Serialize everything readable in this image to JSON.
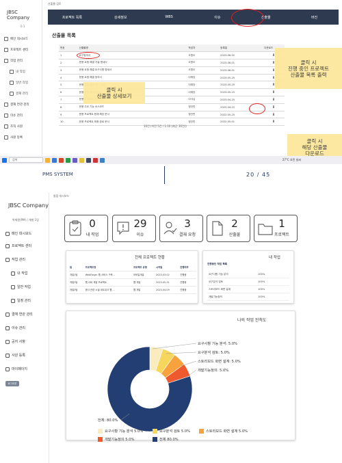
{
  "top": {
    "breadcrumb": "산출물 검토",
    "logo": "JBSC Company",
    "version": "0.1",
    "sidebar": [
      "메인 대시보드",
      "프로젝트 센터",
      "작업 관리",
      "내 작업",
      "일반 작업",
      "결재 관리",
      "결재 연관 관리",
      "이슈 관리",
      "조직 사원",
      "사원 등록"
    ],
    "nav": [
      "프로젝트 목록",
      "상세정보",
      "WBS",
      "이슈",
      "산출물",
      "버전"
    ],
    "page_title": "산출물 목록",
    "table": {
      "headers": [
        "번호",
        "산출물명",
        "작성자",
        "등록일",
        "다운로드"
      ],
      "rows": [
        [
          "1",
          "요구정의서",
          "오명오",
          "2023-06-02",
          "⬇"
        ],
        [
          "2",
          "운용 요청 해결 가설 명세서",
          "오명오",
          "2023-06-01",
          "⬇"
        ],
        [
          "3",
          "운용 요청 해결 요구사항 명세서",
          "오명오",
          "2023-06-01",
          "⬇"
        ],
        [
          "4",
          "운용 요청 해결 정의서",
          "이재당",
          "2023-05-25",
          "⬇"
        ],
        [
          "5",
          "운용 요청 해결 코드 작성",
          "이재당",
          "2023-05-25",
          "⬇"
        ],
        [
          "6",
          "운용 요청 해결 테스트",
          "이재당",
          "2023-05-15",
          "⬇"
        ],
        [
          "7",
          "운용 프로젝트 소스코드",
          "이사님",
          "2023-04-25",
          "⬇"
        ],
        [
          "8",
          "운용 주요 기능 소스코드",
          "정인민",
          "2023-04-15",
          "⬇"
        ],
        [
          "9",
          "운용 프로젝트 현재 해당 문서",
          "정인민",
          "2022-05-25",
          "⬇"
        ],
        [
          "10",
          "운용 프로젝트 최종 완료 문서",
          "정인민",
          "2022-05-01",
          "⬇"
        ]
      ],
      "footer": "10건 (이전 5건 / 1-10 (최근 10건))"
    },
    "callouts": {
      "project_list": "클릭 시\n진행 중인 프로젝트\n산출물 목록 출력",
      "detail": "클릭 시\n산출물 상세보기",
      "download": "클릭 시\n해당 산출물\n다운로드"
    },
    "taskbar": {
      "search": "검색",
      "weather": "27°C 흐린 날씨"
    }
  },
  "divider": {
    "label": "PMS SYSTEM",
    "page": "20",
    "separator": "/",
    "total": "45"
  },
  "bottom": {
    "breadcrumb": "통합 대시보드",
    "logo": "JBSC Company",
    "user": "박재원(PM) / 개발 1팀",
    "sidebar": [
      "메인 대시보드",
      "프로젝트 센터",
      "작업 관리",
      "내 작업",
      "일반 작업",
      "일정 관리",
      "결재 연관 관리",
      "이슈 관리",
      "공지 사항",
      "사원 등록",
      "마이페이지"
    ],
    "logout": "로그아웃",
    "cards": [
      {
        "num": "0",
        "label": "내 작업",
        "icon": "clipboard-icon"
      },
      {
        "num": "29",
        "label": "이슈",
        "icon": "alert-icon"
      },
      {
        "num": "3",
        "label": "결재 요청",
        "icon": "approval-icon"
      },
      {
        "num": "2",
        "label": "산출물",
        "icon": "document-icon"
      },
      {
        "num": "1",
        "label": "프로젝트",
        "icon": "folder-icon"
      }
    ],
    "project_panel": {
      "title": "전체 프로젝트 현황",
      "headers": [
        "팀",
        "프로젝트명",
        "프로젝트 유형",
        "시작일",
        "진행여부"
      ],
      "rows": [
        [
          "개발1팀",
          "WebForge: 웹 서비스 구축...",
          "모바일개발",
          "2023-03-02",
          "진행중"
        ],
        [
          "개발2팀",
          "웹 서버 개발 프로젝트",
          "웹 개발",
          "2023-05-31",
          "진행중"
        ],
        [
          "개발3팀",
          "음식 관련 소셜 네트워크 웹 ...",
          "웹 개발",
          "2023-04-09",
          "진행중"
        ]
      ]
    },
    "task_panel": {
      "title": "내 작업",
      "header": "진행중인 작업 목록",
      "rows": [
        [
          "요구사항 기능 분석",
          "100%"
        ],
        [
          "요구분석 검토",
          "100%"
        ],
        [
          "스토리보드 화면 설계",
          "100%"
        ],
        [
          "개발기능정의",
          "100%"
        ]
      ]
    },
    "progress_panel": {
      "title": "나의 작업 진척도"
    }
  },
  "chart_data": {
    "type": "pie",
    "title": "나의 작업 진척도",
    "categories": [
      "요구사항 기능 분석",
      "요구분석 검토",
      "스토리보드 화면 설계",
      "개발기능정의",
      "전체"
    ],
    "values": [
      5.0,
      5.0,
      5.0,
      5.0,
      80.0
    ],
    "unit": "%",
    "colors": [
      "#fbecc0",
      "#f6d65c",
      "#f7a23c",
      "#ee5a2e",
      "#233e73"
    ],
    "labels": [
      "요구사항 기능 분석: 5.0%",
      "요구분석 검토: 5.0%",
      "스토리보드 화면 설계: 5.0%",
      "개발기능정의: 5.0%",
      "전체: 80.0%"
    ],
    "legend": [
      "요구사항 기능 분석 5.0%",
      "요구분석 검토 5.0%",
      "스토리보드 화면 설계 5.0%",
      "개발기능정의 5.0%",
      "전체 80.0%"
    ],
    "legend_position": "bottom"
  }
}
